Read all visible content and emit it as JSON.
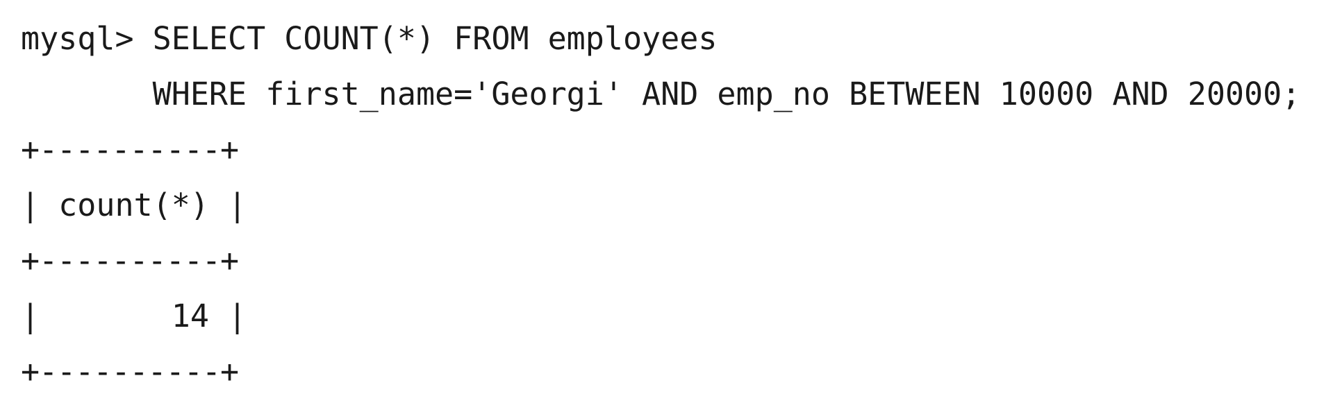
{
  "terminal": {
    "prompt": "mysql> ",
    "continuation_indent": "       ",
    "query_line_1": "SELECT COUNT(*) FROM employees",
    "query_line_2": "WHERE first_name='Georgi' AND emp_no BETWEEN 10000 AND 20000;",
    "result": {
      "border": "+----------+",
      "header_row": "| count(*) |",
      "value_row": "|       14 |",
      "column_header": "count(*)",
      "value": "14"
    }
  }
}
